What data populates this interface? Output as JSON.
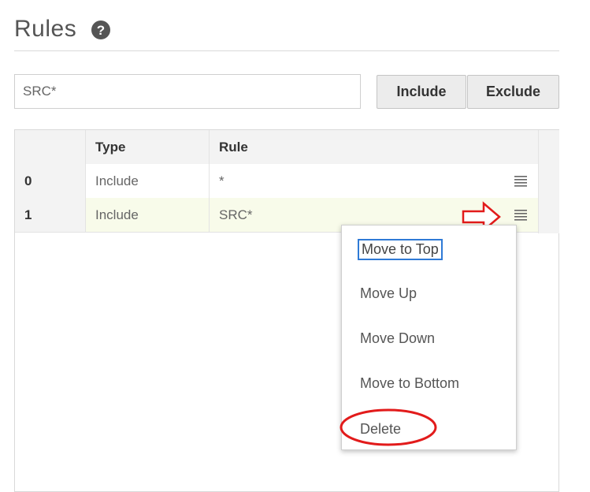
{
  "header": {
    "title": "Rules",
    "help_icon": "question-circle-icon"
  },
  "rule_input": {
    "value": "SRC*"
  },
  "buttons": {
    "include_label": "Include",
    "exclude_label": "Exclude"
  },
  "table": {
    "columns": [
      "",
      "Type",
      "Rule"
    ],
    "rows": [
      {
        "index": "0",
        "type": "Include",
        "rule": "*"
      },
      {
        "index": "1",
        "type": "Include",
        "rule": "SRC*"
      }
    ]
  },
  "context_menu": {
    "items": [
      "Move to Top",
      "Move Up",
      "Move Down",
      "Move to Bottom",
      "Delete"
    ]
  },
  "annotations": {
    "arrow_color": "#e21b1b",
    "highlight_color": "#e21b1b"
  },
  "colors": {
    "selected_row_bg": "#f8fbea",
    "focus_border": "#2f7ad6"
  }
}
